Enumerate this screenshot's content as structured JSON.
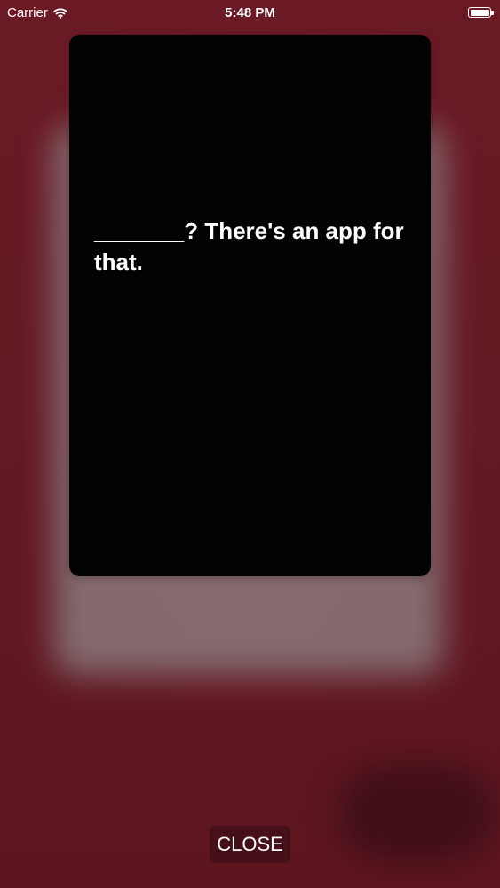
{
  "status_bar": {
    "carrier": "Carrier",
    "time": "5:48 PM",
    "wifi_icon": "wifi-icon",
    "battery_icon": "battery-icon"
  },
  "card": {
    "text": "_______? There's an app for that."
  },
  "actions": {
    "close_label": "CLOSE"
  },
  "colors": {
    "background": "#6a1a24",
    "card": "#020104",
    "text": "#ffffff"
  }
}
